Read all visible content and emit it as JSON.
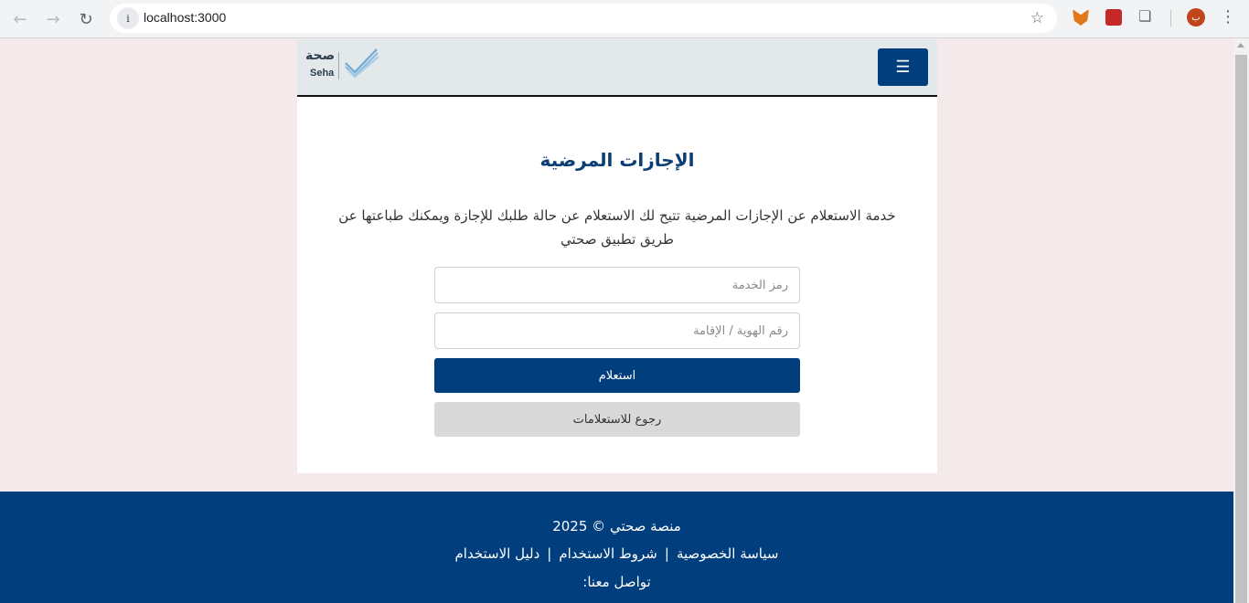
{
  "browser": {
    "url": "localhost:3000",
    "avatar_letter": "ب"
  },
  "header": {
    "logo_ar": "صحة",
    "logo_en": "Seha",
    "menu_icon": "☰"
  },
  "main": {
    "title": "الإجازات المرضية",
    "description": "خدمة الاستعلام عن الإجازات المرضية تتيح لك الاستعلام عن حالة طلبك للإجازة ويمكنك طباعتها عن طريق تطبيق صحتي",
    "seal_placeholder": "رمز الخدمة",
    "id_placeholder": "رقم الهوية / الإقامة",
    "inquire_label": "استعلام",
    "back_label": "رجوع للاستعلامات"
  },
  "footer": {
    "copyright": "منصة صحتي © 2025",
    "links": [
      "سياسة الخصوصية",
      "شروط الاستخدام",
      "دليل الاستخدام"
    ],
    "separator": "|",
    "contact": "تواصل معنا:"
  },
  "colors": {
    "brand_blue": "#003e7e",
    "page_bg": "#f4eaec",
    "header_bg": "#e3e8ea"
  }
}
